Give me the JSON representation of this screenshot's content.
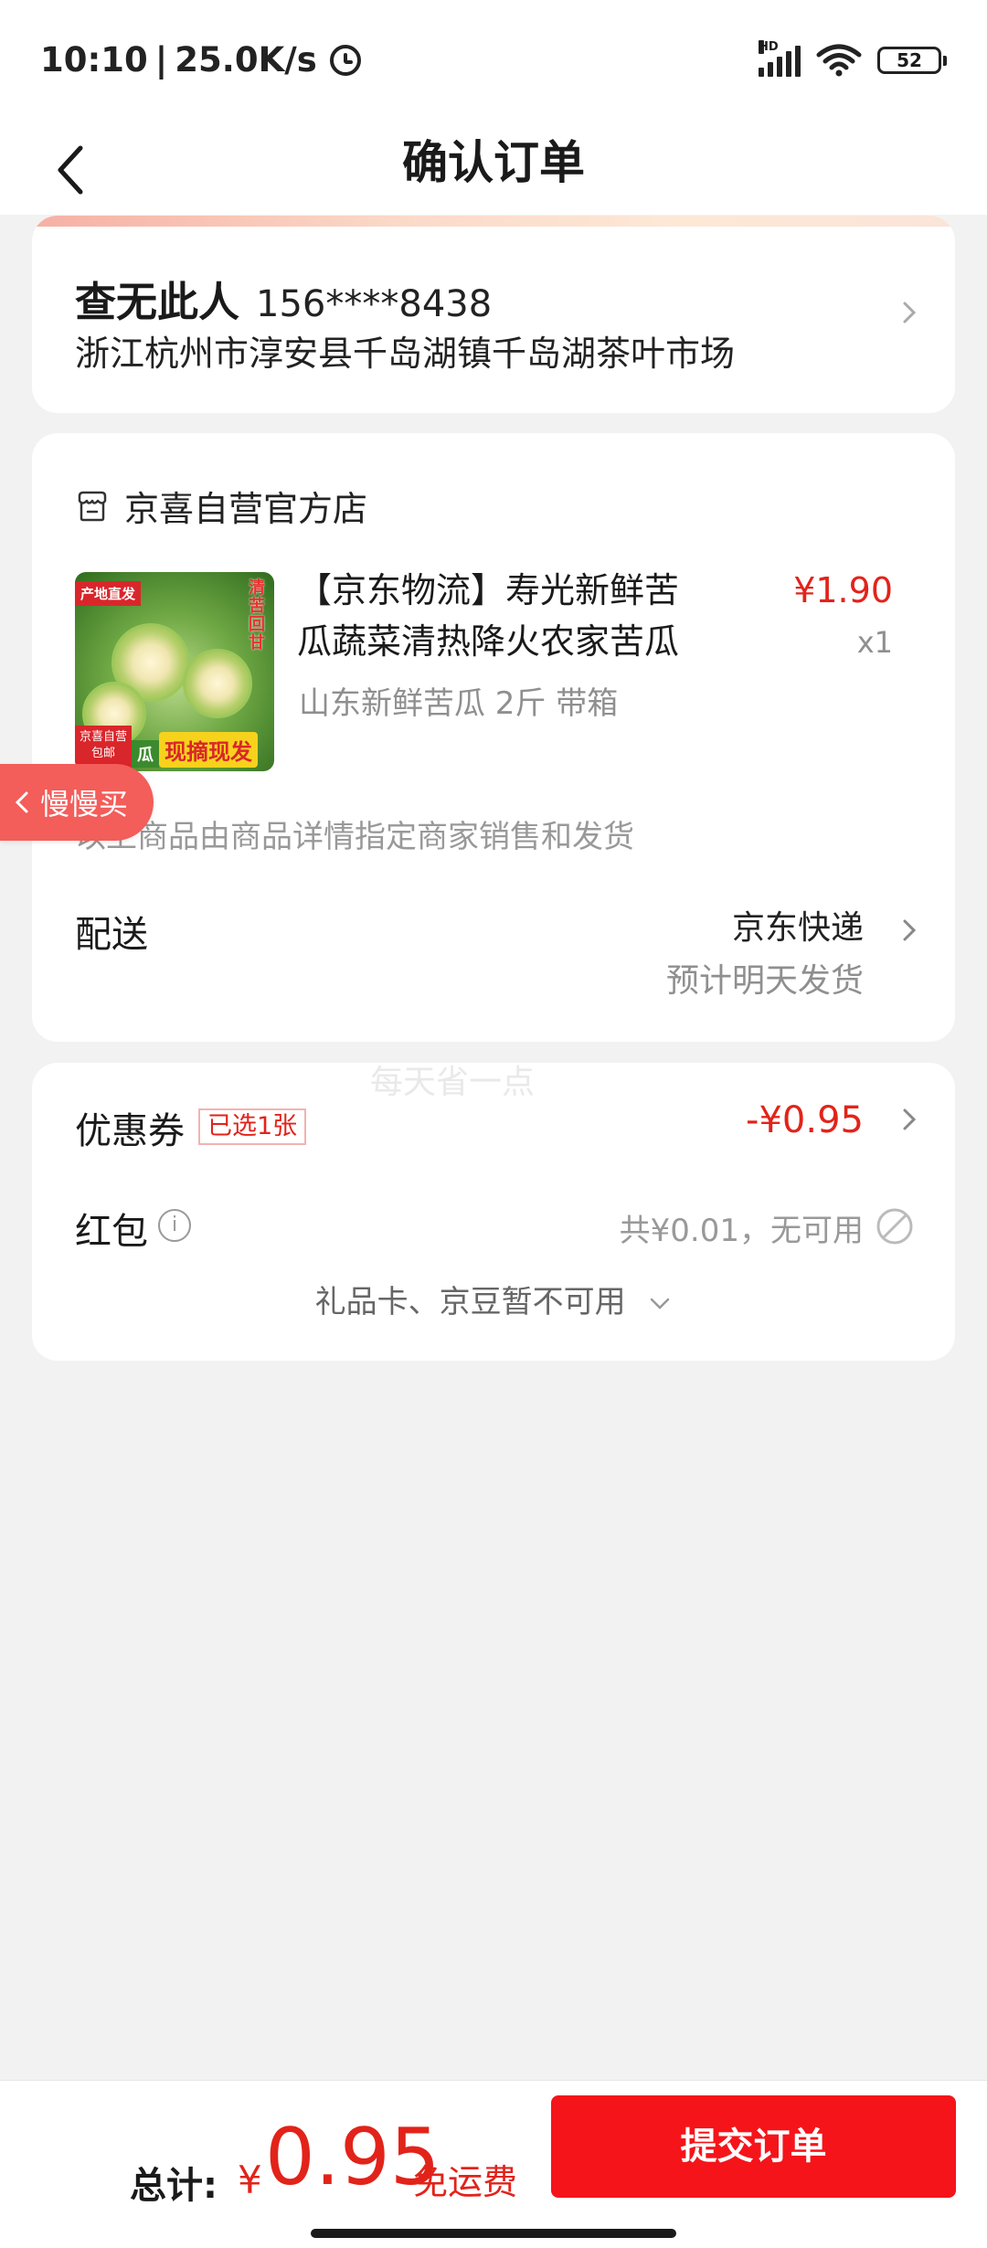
{
  "status_bar": {
    "time": "10:10",
    "network_speed": "25.0K/s",
    "battery": "52",
    "icons": [
      "alarm-icon",
      "signal-icon",
      "wifi-icon",
      "battery-icon"
    ]
  },
  "header": {
    "title": "确认订单",
    "back_icon": "back-arrow-icon"
  },
  "address": {
    "name": "查无此人",
    "phone": "156****8438",
    "detail": "浙江杭州市淳安县千岛湖镇千岛湖茶叶市场"
  },
  "order": {
    "store_name": "京喜自营官方店",
    "product": {
      "title": "【京东物流】寿光新鲜苦瓜蔬菜清热降火农家苦瓜",
      "spec": "山东新鲜苦瓜 2斤 带箱",
      "price": "¥1.90",
      "quantity": "x1",
      "image_texts": {
        "top_tag": "产地直发",
        "vertical": "清苦回甘",
        "bottom_left": "京喜自营 包邮",
        "bottom_mid": "瓜",
        "bottom_right": "现摘现发"
      }
    },
    "seller_note": "以上商品由商品详情指定商家销售和发货",
    "delivery": {
      "label": "配送",
      "method": "京东快递",
      "eta": "预计明天发货"
    }
  },
  "floating": {
    "slow_buy": "慢慢买"
  },
  "watermark": "每天省一点",
  "discounts": {
    "coupon_label": "优惠券",
    "coupon_tag": "已选1张",
    "coupon_amount": "-¥0.95",
    "redpacket_label": "红包",
    "redpacket_status": "共¥0.01，无可用",
    "giftcard_text": "礼品卡、京豆暂不可用"
  },
  "bottom_bar": {
    "total_label": "总计:",
    "currency": "¥",
    "total_amount": "0.95",
    "free_shipping": "免运费",
    "submit_label": "提交订单"
  },
  "colors": {
    "accent_red": "#e2231a",
    "submit_red": "#f5141a",
    "background": "#f2f2f2"
  }
}
